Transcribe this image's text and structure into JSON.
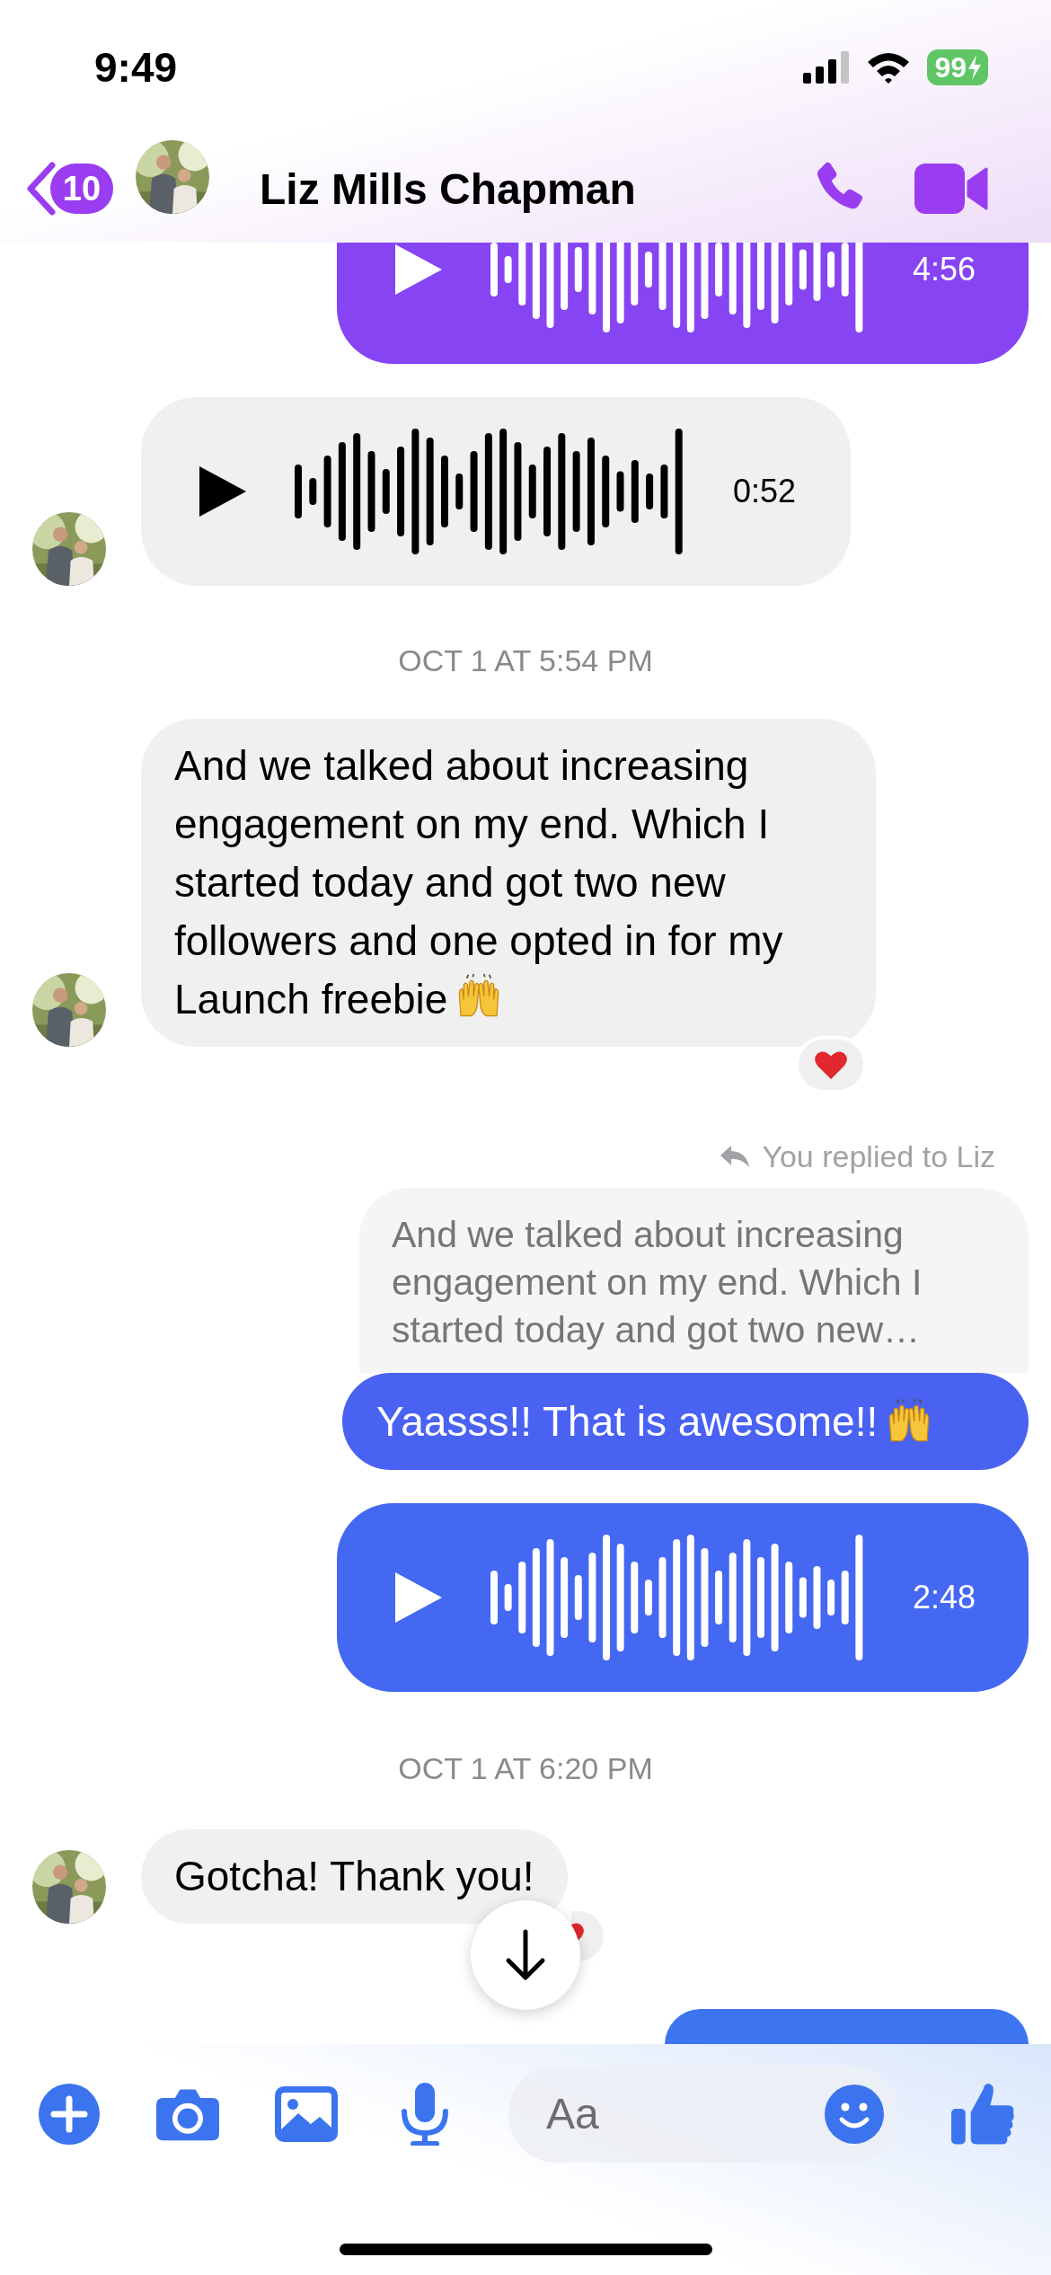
{
  "status_bar": {
    "time": "9:49",
    "battery": "99"
  },
  "header": {
    "back_badge": "10",
    "contact_name": "Liz Mills Chapman"
  },
  "messages": [
    {
      "kind": "audio",
      "outgoing": true,
      "cut": true,
      "duration": "4:56"
    },
    {
      "kind": "audio",
      "outgoing": false,
      "cut": false,
      "duration": "0:52",
      "avatar": true
    },
    {
      "kind": "timestamp",
      "text": "OCT 1 AT 5:54 PM"
    },
    {
      "kind": "text",
      "text": "And we talked about increasing engagement on my end. Which I started today and got two new followers and one opted in for my Launch freebie",
      "raised_hands_emoji": true,
      "hearted": true,
      "avatar": true
    },
    {
      "kind": "reply",
      "label": "You replied to Liz",
      "quote": "And we talked about increasing engagement on my end. Which I started today and got two new…",
      "text": "Yaasss!! That is awesome!!",
      "raised_hands_emoji": true
    },
    {
      "kind": "audio",
      "outgoing": true,
      "cut": false,
      "duration": "2:48"
    },
    {
      "kind": "timestamp",
      "text": "OCT 1 AT 6:20 PM"
    },
    {
      "kind": "text",
      "text": "Gotcha! Thank you!",
      "hearted": true,
      "avatar": true
    },
    {
      "kind": "partial",
      "outgoing": true
    }
  ],
  "composer": {
    "placeholder": "Aa"
  }
}
